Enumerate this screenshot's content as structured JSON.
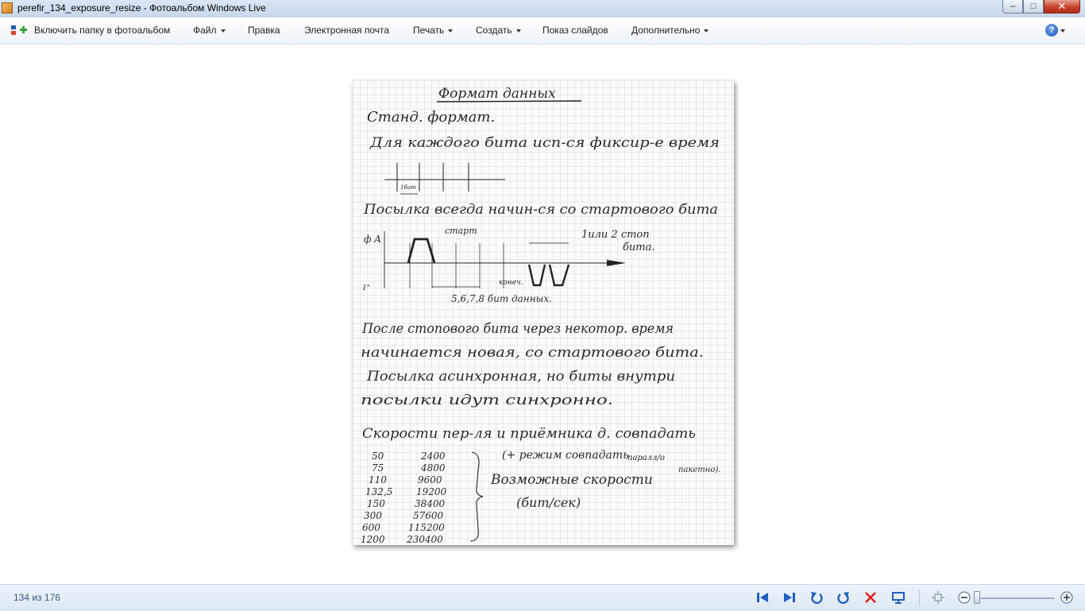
{
  "window": {
    "title": "perefir_134_exposure_resize - Фотоальбом Windows Live",
    "controls": {
      "minimize": "–",
      "maximize": "□",
      "close": "✕"
    }
  },
  "menu": {
    "include_folder": "Включить папку в фотоальбом",
    "file": "Файл",
    "edit": "Правка",
    "email": "Электронная почта",
    "print": "Печать",
    "create": "Создать",
    "slideshow": "Показ слайдов",
    "extras": "Дополнительно",
    "help": "?"
  },
  "photo": {
    "handwriting": {
      "heading": "Формат данных",
      "line1": "Станд. формат.",
      "line2": "Для каждого бита исп-ся фиксир-е время",
      "bit_label": "1бит",
      "line3": "Посылка всегда начин-ся со стартового бита",
      "axis_y": "ф A",
      "start_label": "старт",
      "stop_label": "1или 2 стоп",
      "stop_label2": "бита.",
      "end_label": "конеч.",
      "zero_label": "1\"",
      "data_bits": "5,6,7,8 бит данных.",
      "p1": "После стопового бита через некотор. время",
      "p2": "начинается новая, со стартового бита.",
      "p3": "Посылка асинхронная, но биты внутри",
      "p4": "посылки идут синхронно.",
      "p5": "Скорости пер-ля и приёмника д. совпадать",
      "note1": "(+ режим совпадать",
      "note1b": "паралл/о",
      "note1c": "пакетно).",
      "note2": "Возможные скорости",
      "note3": "(бит/сек)",
      "speeds_left": [
        "50",
        "75",
        "110",
        "132,5",
        "150",
        "300",
        "600",
        "1200"
      ],
      "speeds_right": [
        "2400",
        "4800",
        "9600",
        "19200",
        "38400",
        "57600",
        "115200",
        "230400"
      ]
    }
  },
  "status": {
    "counter": "134 из 176"
  },
  "toolbar": {
    "icons": [
      "previous-icon",
      "next-icon",
      "rotate-left-icon",
      "rotate-right-icon",
      "delete-icon",
      "slideshow-icon",
      "actual-size-icon",
      "zoom-out-icon",
      "zoom-in-icon"
    ],
    "zoom_level": 0
  },
  "colors": {
    "accent": "#1f5fbf",
    "delete": "#d9221b",
    "titlebar": "#c7d7ec"
  }
}
